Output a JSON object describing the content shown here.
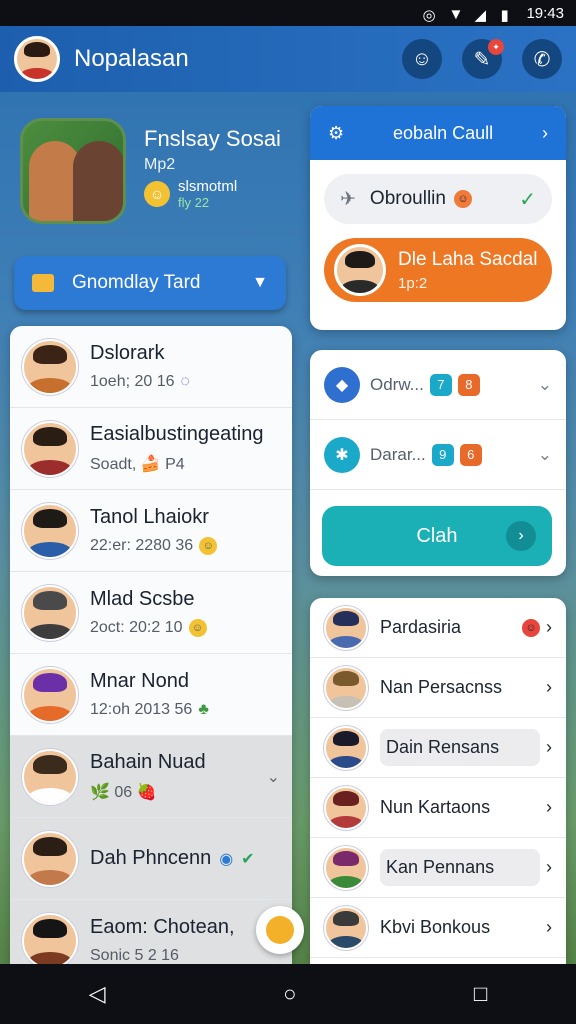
{
  "status_bar": {
    "time": "19:43"
  },
  "app_bar": {
    "title": "Nopalasan"
  },
  "profile": {
    "name": "Fnslsay Sosai",
    "sub": "Mp2",
    "status": "slsmotml",
    "status2": "fly 22"
  },
  "dropdown": {
    "label": "Gnomdlay Tard"
  },
  "contacts": [
    {
      "name": "Dslorark",
      "meta": "1oeh; 20 16",
      "hair": "#3b2416",
      "shirt": "#c76f2c"
    },
    {
      "name": "Easialbustingeating",
      "meta": "Soadt, 🍰 P4",
      "hair": "#2a1d14",
      "shirt": "#9c2d2d"
    },
    {
      "name": "Tanol Lhaiokr",
      "meta": "22:er: 2280 36",
      "hair": "#1d1a18",
      "shirt": "#2b5ea8"
    },
    {
      "name": "Mlad Scsbe",
      "meta": "2oct: 20:2 10",
      "hair": "#4a4a4a",
      "shirt": "#3d3d3d"
    },
    {
      "name": "Mnar Nond",
      "meta": "12:oh 2013 56",
      "hair": "#6b2fa8",
      "shirt": "#e46b2a"
    },
    {
      "name": "Bahain Nuad",
      "meta": "🌿 06 🍓",
      "hair": "#3b2b1c",
      "shirt": "#ffffff"
    },
    {
      "name": "Dah Phncenn",
      "meta": "",
      "hair": "#2b1f15",
      "shirt": "#c27a4a"
    },
    {
      "name": "Eaom: Chotean,",
      "meta": "Sonic 5 2 16",
      "hair": "#151515",
      "shirt": "#7d3a22"
    }
  ],
  "call_card": {
    "title": "eobaln Caull",
    "row_label": "Obroullin",
    "active_name": "Dle Laha Sacdal",
    "active_sub": "1p:2"
  },
  "options": [
    {
      "label": "Odrw...",
      "tag1": "7",
      "tag2": "8"
    },
    {
      "label": "Darar...",
      "tag1": "9",
      "tag2": "6"
    }
  ],
  "call_button": {
    "label": "Clah"
  },
  "friends": [
    {
      "name": "Pardasiria",
      "hair": "#25305a",
      "shirt": "#4a6ab0"
    },
    {
      "name": "Nan Persacnss",
      "hair": "#7a5a2c",
      "shirt": "#c7c0b4"
    },
    {
      "name": "Dain Rensans",
      "hair": "#1a1a2a",
      "shirt": "#2b4b8a"
    },
    {
      "name": "Nun Kartaons",
      "hair": "#6b2020",
      "shirt": "#b23a3a"
    },
    {
      "name": "Kan Pennans",
      "hair": "#7a2a6a",
      "shirt": "#3a8a3a"
    },
    {
      "name": "Kbvi Bonkous",
      "hair": "#3a3a3a",
      "shirt": "#2a4a6a"
    }
  ],
  "colors": {
    "app_bar": "#1d5fae",
    "call_button": "#1ab0b5",
    "active_call": "#ee7724",
    "accent_blue": "#1f72d6"
  }
}
